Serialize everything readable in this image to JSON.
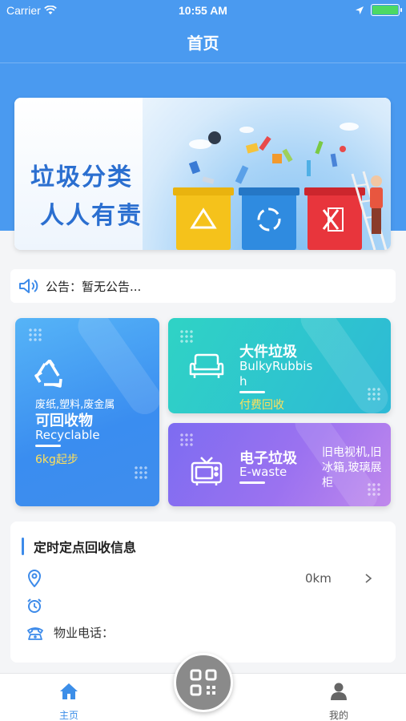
{
  "status_bar": {
    "carrier": "Carrier",
    "time": "10:55 AM"
  },
  "nav": {
    "title": "首页"
  },
  "banner": {
    "slogan_line1": "垃圾分类",
    "slogan_line2": "人人有责"
  },
  "notice": {
    "label": "公告：",
    "text": "暂无公告..."
  },
  "categories": {
    "recyclable": {
      "desc": "废纸,塑料,废金属",
      "title": "可回收物",
      "subtitle": "Recyclable",
      "note": "6kg起步"
    },
    "bulky": {
      "title": "大件垃圾",
      "subtitle_line1": "BulkyRubbis",
      "subtitle_line2": "h",
      "note": "付费回收"
    },
    "ewaste": {
      "title": "电子垃圾",
      "subtitle": "E-waste",
      "desc_line1": "旧电视机,旧",
      "desc_line2": "冰箱,玻璃展",
      "desc_line3": "柜"
    }
  },
  "schedule": {
    "title": "定时定点回收信息",
    "location": "",
    "distance": "0km",
    "time": "",
    "phone_label": "物业电话："
  },
  "tabbar": {
    "home": "主页",
    "mine": "我的"
  },
  "colors": {
    "primary": "#4a9af0",
    "accent_yellow": "#ffe05a",
    "tab_active": "#3c8ee8"
  }
}
